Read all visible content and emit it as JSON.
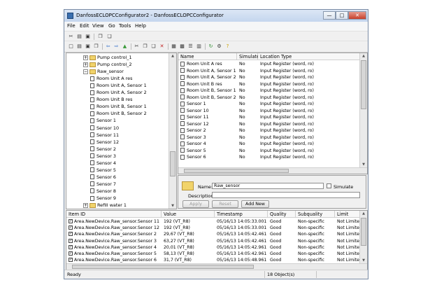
{
  "window": {
    "title": "DanfossECLOPCConfigurator2 - DanfossECLOPCConfigurator",
    "min_glyph": "—",
    "max_glyph": "□",
    "close_glyph": "✕"
  },
  "menu": [
    "File",
    "Edit",
    "View",
    "Go",
    "Tools",
    "Help"
  ],
  "tree": {
    "items": [
      {
        "label": "Pump control_1",
        "kind": "folder",
        "expander": "+",
        "indent": 0
      },
      {
        "label": "Pump control_2",
        "kind": "folder",
        "expander": "+",
        "indent": 0
      },
      {
        "label": "Raw_sensor",
        "kind": "folder",
        "expander": "−",
        "indent": 0
      },
      {
        "label": "Room Unit A res",
        "kind": "tag",
        "indent": 1
      },
      {
        "label": "Room Unit A, Sensor 1",
        "kind": "tag",
        "indent": 1
      },
      {
        "label": "Room Unit A, Sensor 2",
        "kind": "tag",
        "indent": 1
      },
      {
        "label": "Room Unit B res",
        "kind": "tag",
        "indent": 1
      },
      {
        "label": "Room Unit B, Sensor 1",
        "kind": "tag",
        "indent": 1
      },
      {
        "label": "Room Unit B, Sensor 2",
        "kind": "tag",
        "indent": 1
      },
      {
        "label": "Sensor 1",
        "kind": "tag",
        "indent": 1
      },
      {
        "label": "Sensor 10",
        "kind": "tag",
        "indent": 1
      },
      {
        "label": "Sensor 11",
        "kind": "tag",
        "indent": 1
      },
      {
        "label": "Sensor 12",
        "kind": "tag",
        "indent": 1
      },
      {
        "label": "Sensor 2",
        "kind": "tag",
        "indent": 1
      },
      {
        "label": "Sensor 3",
        "kind": "tag",
        "indent": 1
      },
      {
        "label": "Sensor 4",
        "kind": "tag",
        "indent": 1
      },
      {
        "label": "Sensor 5",
        "kind": "tag",
        "indent": 1
      },
      {
        "label": "Sensor 6",
        "kind": "tag",
        "indent": 1
      },
      {
        "label": "Sensor 7",
        "kind": "tag",
        "indent": 1
      },
      {
        "label": "Sensor 8",
        "kind": "tag",
        "indent": 1
      },
      {
        "label": "Sensor 9",
        "kind": "tag",
        "indent": 1
      },
      {
        "label": "Refill water 1",
        "kind": "folder",
        "expander": "+",
        "indent": 0
      }
    ]
  },
  "list": {
    "columns": [
      "Name",
      "Simulate",
      "Location Type"
    ],
    "rows": [
      {
        "name": "Room Unit A res",
        "simulate": "No",
        "location": "Input Register (word, ro)"
      },
      {
        "name": "Room Unit A, Sensor 1",
        "simulate": "No",
        "location": "Input Register (word, ro)"
      },
      {
        "name": "Room Unit A, Sensor 2",
        "simulate": "No",
        "location": "Input Register (word, ro)"
      },
      {
        "name": "Room Unit B res",
        "simulate": "No",
        "location": "Input Register (word, ro)"
      },
      {
        "name": "Room Unit B, Sensor 1",
        "simulate": "No",
        "location": "Input Register (word, ro)"
      },
      {
        "name": "Room Unit B, Sensor 2",
        "simulate": "No",
        "location": "Input Register (word, ro)"
      },
      {
        "name": "Sensor 1",
        "simulate": "No",
        "location": "Input Register (word, ro)"
      },
      {
        "name": "Sensor 10",
        "simulate": "No",
        "location": "Input Register (word, ro)"
      },
      {
        "name": "Sensor 11",
        "simulate": "No",
        "location": "Input Register (word, ro)"
      },
      {
        "name": "Sensor 12",
        "simulate": "No",
        "location": "Input Register (word, ro)"
      },
      {
        "name": "Sensor 2",
        "simulate": "No",
        "location": "Input Register (word, ro)"
      },
      {
        "name": "Sensor 3",
        "simulate": "No",
        "location": "Input Register (word, ro)"
      },
      {
        "name": "Sensor 4",
        "simulate": "No",
        "location": "Input Register (word, ro)"
      },
      {
        "name": "Sensor 5",
        "simulate": "No",
        "location": "Input Register (word, ro)"
      },
      {
        "name": "Sensor 6",
        "simulate": "No",
        "location": "Input Register (word, ro)"
      }
    ]
  },
  "detail": {
    "name_label": "Name:",
    "name_value": "Raw_sensor",
    "simulate_label": "Simulate",
    "description_label": "Description:",
    "description_value": "",
    "apply_label": "Apply",
    "reset_label": "Reset",
    "add_new_label": "Add New"
  },
  "grid": {
    "columns": [
      "Item ID",
      "Value",
      "Timestamp",
      "Quality",
      "Subquality",
      "Limit"
    ],
    "rows": [
      {
        "item": "Area.NewDevice.Raw_sensor.Sensor 11",
        "value": "192 (VT_R8)",
        "timestamp": "05/16/13 14:05:33.001",
        "quality": "Good",
        "subquality": "Non-specific",
        "limit": "Not Limited"
      },
      {
        "item": "Area.NewDevice.Raw_sensor.Sensor 12",
        "value": "192 (VT_R8)",
        "timestamp": "05/16/13 14:05:33.001",
        "quality": "Good",
        "subquality": "Non-specific",
        "limit": "Not Limited"
      },
      {
        "item": "Area.NewDevice.Raw_sensor.Sensor 2",
        "value": "29,67 (VT_R8)",
        "timestamp": "05/16/13 14:05:42.461",
        "quality": "Good",
        "subquality": "Non-specific",
        "limit": "Not Limited"
      },
      {
        "item": "Area.NewDevice.Raw_sensor.Sensor 3",
        "value": "63,27 (VT_R8)",
        "timestamp": "05/16/13 14:05:42.461",
        "quality": "Good",
        "subquality": "Non-specific",
        "limit": "Not Limited"
      },
      {
        "item": "Area.NewDevice.Raw_sensor.Sensor 4",
        "value": "20,01 (VT_R8)",
        "timestamp": "05/16/13 14:05:42.961",
        "quality": "Good",
        "subquality": "Non-specific",
        "limit": "Not Limited"
      },
      {
        "item": "Area.NewDevice.Raw_sensor.Sensor 5",
        "value": "58,13 (VT_R8)",
        "timestamp": "05/16/13 14:05:42.961",
        "quality": "Good",
        "subquality": "Non-specific",
        "limit": "Not Limited"
      },
      {
        "item": "Area.NewDevice.Raw_sensor.Sensor 6",
        "value": "31,7 (VT_R8)",
        "timestamp": "05/16/13 14:05:48.961",
        "quality": "Good",
        "subquality": "Non-specific",
        "limit": "Not Limited"
      }
    ]
  },
  "status": {
    "left": "Ready",
    "middle": "18 Object(s)"
  },
  "toolbar1": [
    "cut-icon",
    "open-icon",
    "save-icon",
    "copy-icon",
    "paste-icon"
  ],
  "toolbar2": [
    "new-icon",
    "open-icon",
    "save-icon",
    "copy-icon",
    "back-icon",
    "forward-icon",
    "up-icon",
    "cut-icon",
    "copy-icon",
    "paste-icon",
    "delete-icon",
    "large-icons-icon",
    "small-icons-icon",
    "list-icon",
    "details-icon",
    "refresh-icon",
    "properties-icon",
    "help-icon"
  ],
  "colors": {
    "folder": "#f1d36b",
    "title_bar": "#c4d6ee",
    "close_button": "#c7402a"
  }
}
